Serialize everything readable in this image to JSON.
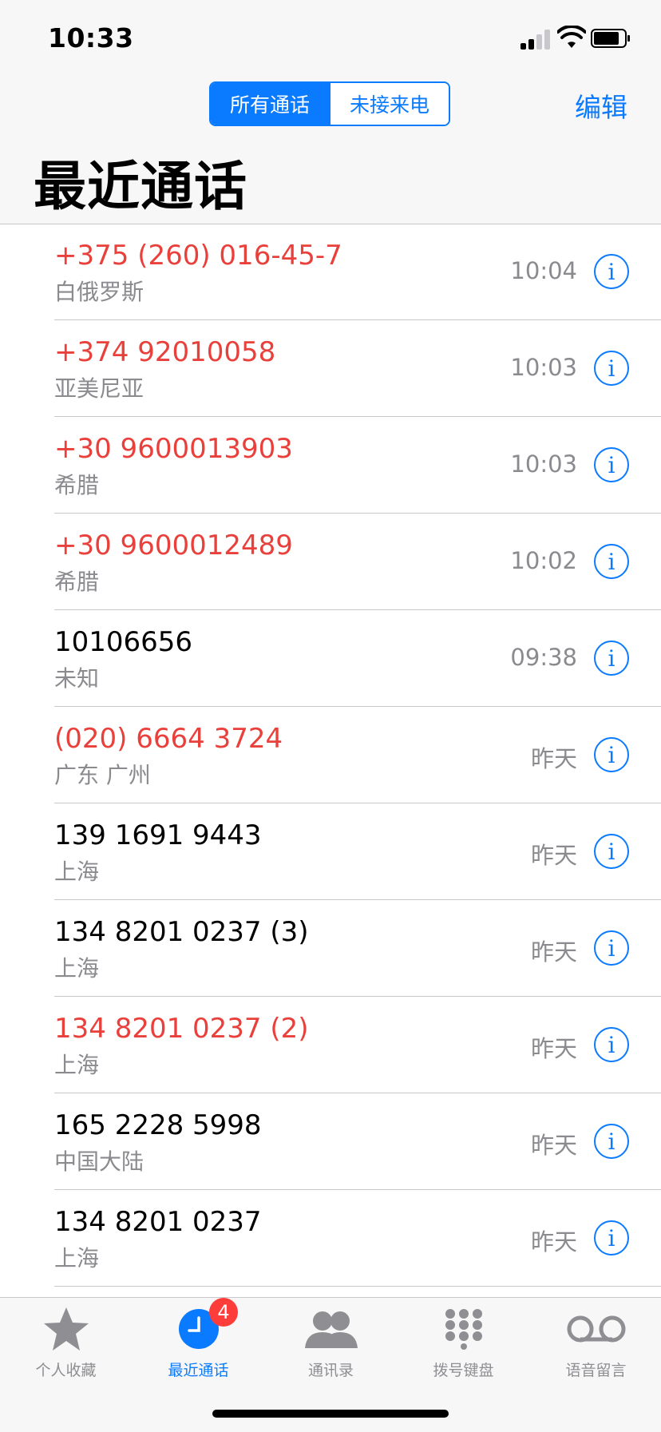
{
  "status_bar": {
    "time": "10:33"
  },
  "header": {
    "segments": [
      "所有通话",
      "未接来电"
    ],
    "edit_label": "编辑",
    "title": "最近通话"
  },
  "calls": [
    {
      "number": "+375 (260) 016-45-7",
      "location": "白俄罗斯",
      "time": "10:04",
      "missed": true
    },
    {
      "number": "+374 92010058",
      "location": "亚美尼亚",
      "time": "10:03",
      "missed": true
    },
    {
      "number": "+30 9600013903",
      "location": "希腊",
      "time": "10:03",
      "missed": true
    },
    {
      "number": "+30 9600012489",
      "location": "希腊",
      "time": "10:02",
      "missed": true
    },
    {
      "number": "10106656",
      "location": "未知",
      "time": "09:38",
      "missed": false
    },
    {
      "number": "(020) 6664 3724",
      "location": "广东 广州",
      "time": "昨天",
      "missed": true
    },
    {
      "number": "139 1691 9443",
      "location": "上海",
      "time": "昨天",
      "missed": false
    },
    {
      "number": "134 8201 0237 (3)",
      "location": "上海",
      "time": "昨天",
      "missed": false
    },
    {
      "number": "134 8201 0237 (2)",
      "location": "上海",
      "time": "昨天",
      "missed": true
    },
    {
      "number": "165 2228 5998",
      "location": "中国大陆",
      "time": "昨天",
      "missed": false
    },
    {
      "number": "134 8201 0237",
      "location": "上海",
      "time": "昨天",
      "missed": false
    }
  ],
  "info_glyph": "i",
  "tab_bar": {
    "tabs": [
      {
        "label": "个人收藏",
        "icon": "star-icon"
      },
      {
        "label": "最近通话",
        "icon": "clock-icon",
        "active": true,
        "badge": "4"
      },
      {
        "label": "通讯录",
        "icon": "contacts-icon"
      },
      {
        "label": "拨号键盘",
        "icon": "keypad-icon"
      },
      {
        "label": "语音留言",
        "icon": "voicemail-icon"
      }
    ]
  },
  "colors": {
    "accent": "#0a7aff",
    "missed": "#e9403b",
    "badge": "#fc3d39"
  }
}
